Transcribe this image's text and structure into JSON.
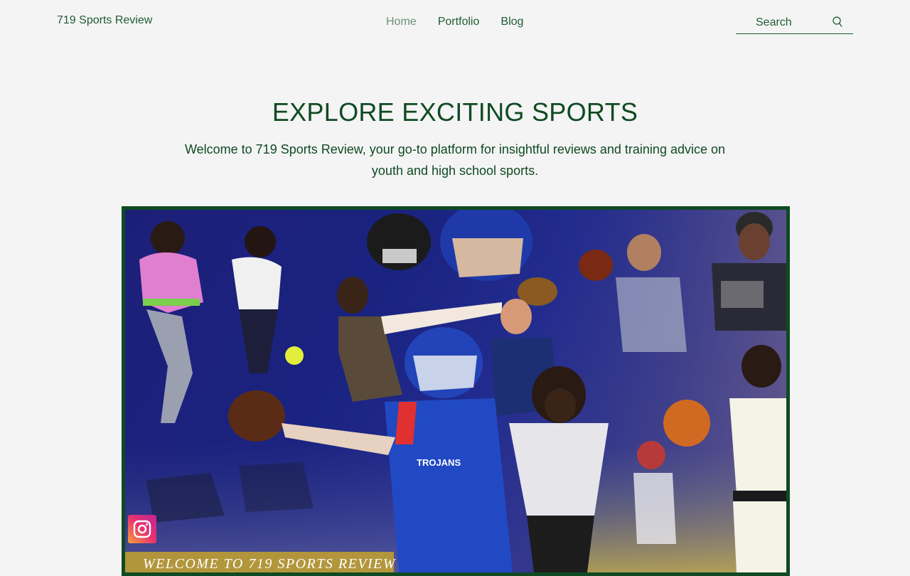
{
  "header": {
    "site_name": "719 Sports Review",
    "nav": [
      {
        "label": "Home",
        "active": true
      },
      {
        "label": "Portfolio",
        "active": false
      },
      {
        "label": "Blog",
        "active": false
      }
    ],
    "search_placeholder": "Search",
    "search_icon": "search-icon"
  },
  "hero": {
    "title": "EXPLORE EXCITING SPORTS",
    "text": "Welcome to 719 Sports Review, your go-to platform for insightful reviews and training advice on youth and high school sports."
  },
  "banner": {
    "caption": "WELCOME TO 719 SPORTS REVIEW",
    "jersey_text": "TROJANS",
    "social_icon": "instagram-icon"
  },
  "colors": {
    "brand_green": "#0f4a23",
    "nav_active": "#6b9077",
    "background": "#f4f4f4"
  }
}
